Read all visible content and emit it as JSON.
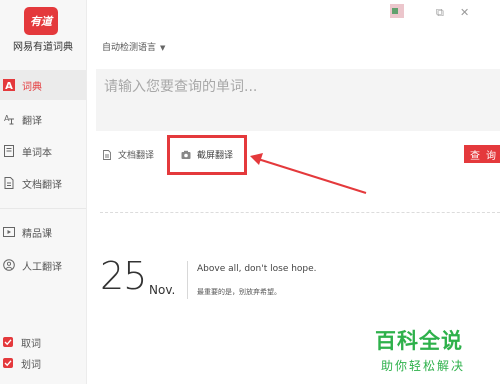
{
  "app": {
    "logo_text": "有道",
    "name": "网易有道词典"
  },
  "sidebar": {
    "items": [
      {
        "label": "词典",
        "icon": "dict-icon",
        "active": true
      },
      {
        "label": "翻译",
        "icon": "translate-icon",
        "active": false
      },
      {
        "label": "单词本",
        "icon": "wordbook-icon",
        "active": false
      },
      {
        "label": "文档翻译",
        "icon": "document-icon",
        "active": false
      },
      {
        "label": "精品课",
        "icon": "course-icon",
        "active": false
      },
      {
        "label": "人工翻译",
        "icon": "human-translate-icon",
        "active": false
      }
    ],
    "checks": [
      {
        "label": "取词",
        "checked": true
      },
      {
        "label": "划词",
        "checked": true
      }
    ]
  },
  "window_controls": {
    "restore_icon": "⧉",
    "close_icon": "✕"
  },
  "search": {
    "language": "自动检测语言",
    "placeholder": "请输入您要查询的单词...",
    "doc_translate": "文档翻译",
    "screenshot_translate": "截屏翻译",
    "button_label": "查询"
  },
  "daily": {
    "day": "25",
    "month": "Nov.",
    "quote_en": "Above all, don't lose hope.",
    "quote_cn": "最重要的是，别放弃希望。"
  },
  "watermark": {
    "title": "百科全说",
    "subtitle": "助你轻松解决"
  },
  "colors": {
    "accent": "#e4393c",
    "watermark": "#2eb14b"
  }
}
